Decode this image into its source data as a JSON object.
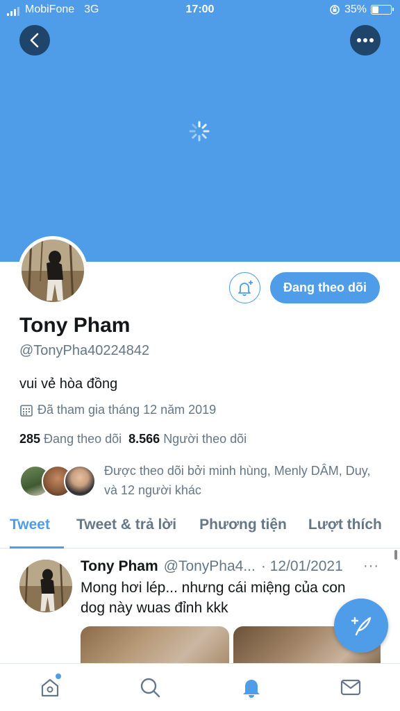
{
  "status_bar": {
    "carrier": "MobiFone",
    "network": "3G",
    "time": "17:00",
    "battery": "35%",
    "battery_level": 0.35
  },
  "profile": {
    "name": "Tony Pham",
    "handle": "@TonyPha40224842",
    "bio": "vui vẻ hòa đồng",
    "joined": "Đã tham gia tháng 12 năm 2019",
    "following_count": "285",
    "following_label": "Đang theo dõi",
    "followers_count": "8.566",
    "followers_label": "Người theo dõi",
    "followed_by": "Được theo dõi bởi minh hùng, Menly DÂM, Duy, và 12 người khác",
    "follow_button": "Đang theo dõi"
  },
  "tabs": [
    {
      "label": "Tweet",
      "active": true
    },
    {
      "label": "Tweet & trả lời",
      "active": false
    },
    {
      "label": "Phương tiện",
      "active": false
    },
    {
      "label": "Lượt thích",
      "active": false
    }
  ],
  "tweet": {
    "author": "Tony Pham",
    "handle": "@TonyPha4...",
    "date": "· 12/01/2021",
    "more": "···",
    "text": "Mong hơi lép... nhưng cái miệng của con dog này wuas đỉnh kkk"
  },
  "icons": {
    "back": "back-icon",
    "more": "more-icon",
    "bell_add": "bell-add-icon",
    "calendar": "calendar-icon",
    "compose": "compose-icon",
    "home": "home-icon",
    "search": "search-icon",
    "notifications": "notifications-icon",
    "messages": "messages-icon"
  },
  "colors": {
    "accent": "#4f9de8",
    "banner": "#4f9de8",
    "dark_button": "#20456b",
    "muted_text": "#657786"
  }
}
